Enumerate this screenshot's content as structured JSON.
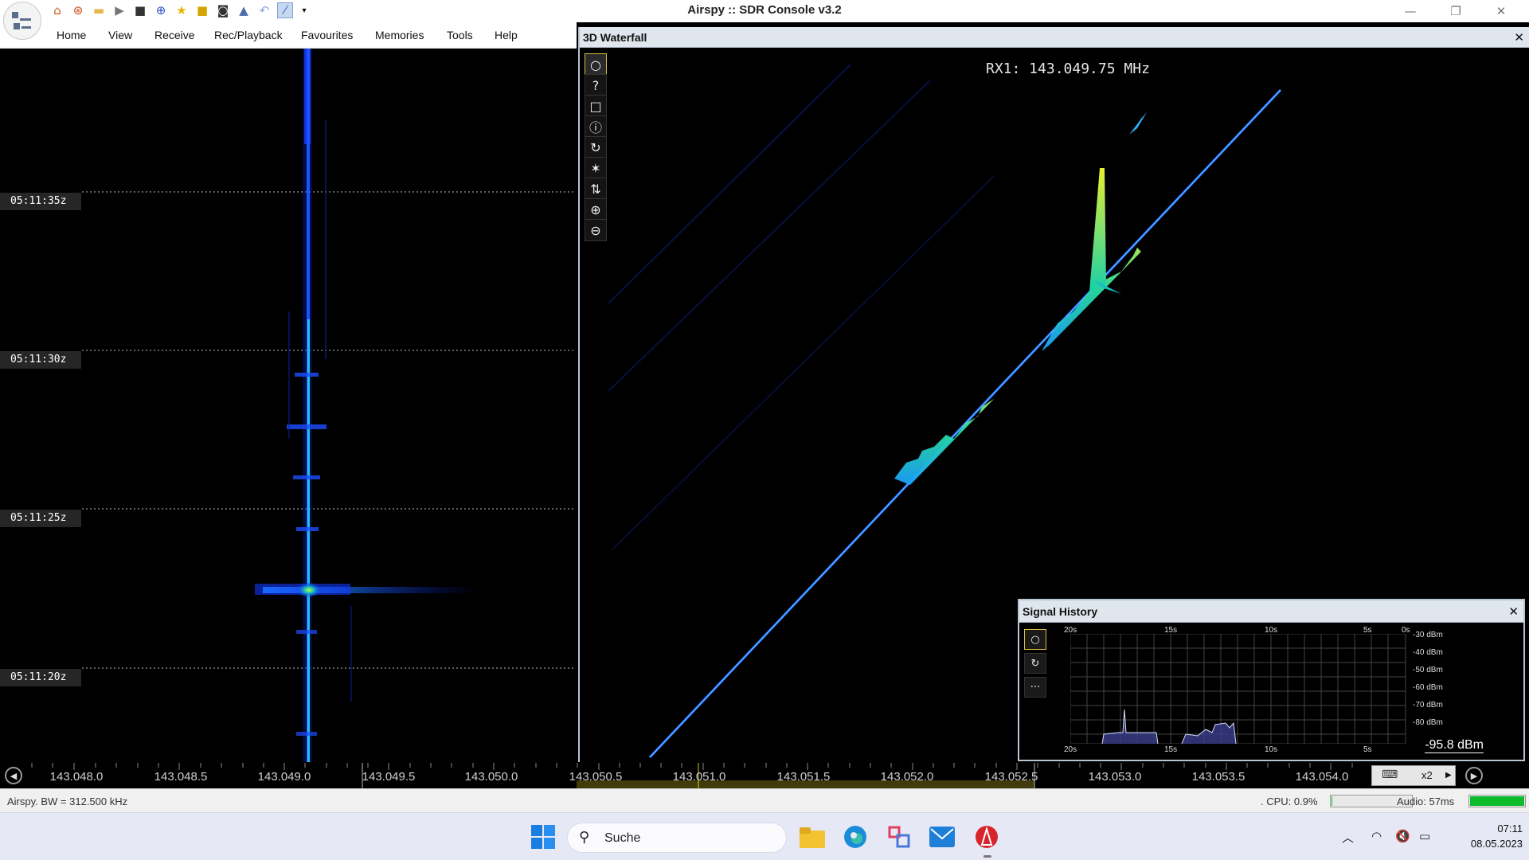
{
  "window": {
    "title": "Airspy :: SDR Console v3.2"
  },
  "menu": [
    "Home",
    "View",
    "Receive",
    "Rec/Playback",
    "Favourites",
    "Memories",
    "Tools",
    "Help"
  ],
  "waterfall": {
    "timestamps": [
      "05:11:35z",
      "05:11:30z",
      "05:11:25z",
      "05:11:20z"
    ]
  },
  "panel3d": {
    "title": "3D Waterfall",
    "readout": "RX1: 143.049.75 MHz",
    "tools": [
      "circle-icon",
      "help-icon",
      "square-icon",
      "info-icon",
      "rotate-icon",
      "asterisk-icon",
      "updown-icon",
      "zoom-in-icon",
      "zoom-out-icon"
    ],
    "tool_glyphs": [
      "○",
      "?",
      "□",
      "ⓘ",
      "↻",
      "✶",
      "⇅",
      "⊕",
      "⊖"
    ]
  },
  "signal_history": {
    "title": "Signal History",
    "time_labels": [
      "20s",
      "15s",
      "10s",
      "5s",
      "0s"
    ],
    "bottom_time_labels": [
      "20s",
      "15s",
      "10s",
      "5s"
    ],
    "db_labels": [
      "-30 dBm",
      "-40 dBm",
      "-50 dBm",
      "-60 dBm",
      "-70 dBm",
      "-80 dBm"
    ],
    "level": "-95.8 dBm",
    "button_glyphs": [
      "○",
      "↻",
      "···"
    ]
  },
  "freq_scale": {
    "labels": [
      "143.048.0",
      "143.048.5",
      "143.049.0",
      "143.049.5",
      "143.050.0",
      "143.050.5",
      "143.051.0",
      "143.051.5",
      "143.052.0",
      "143.052.5",
      "143.053.0",
      "143.053.5",
      "143.054.0"
    ],
    "zoom": "x2"
  },
  "status": {
    "left": "Airspy. BW = 312.500 kHz",
    "cpu": ". CPU: 0.9%",
    "cpu_fraction": 0.01,
    "audio": "Audio: 57ms",
    "audio_fraction": 1.0
  },
  "taskbar": {
    "search": "Suche",
    "time": "07:11",
    "date": "08.05.2023"
  },
  "colors": {
    "accent": "#0dbb2b",
    "signal": "#1e6bff",
    "peak": "#c8e832"
  }
}
